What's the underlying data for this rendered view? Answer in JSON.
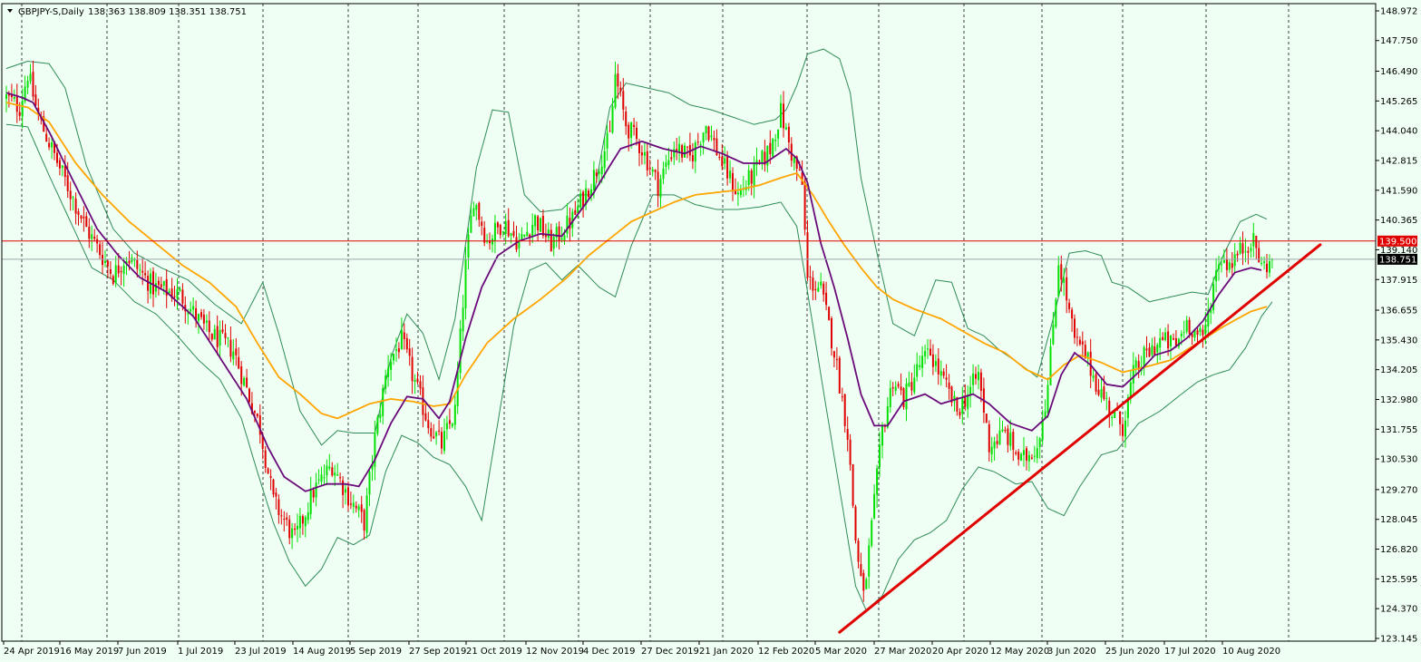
{
  "window": {
    "title": "GBPJPY-S,Daily",
    "ohlc": "138.363 138.809 138.351 138.751",
    "collapse_icon": "triangle-down-icon"
  },
  "colors": {
    "background": "#F0FFF4",
    "bull": "#00E000",
    "bear": "#E00000",
    "ma_fast": "#6A0A7A",
    "ma_slow": "#FFA500",
    "bands": "#2E8B57",
    "level_line": "#E00000",
    "current_line": "#9AA4AC",
    "trendline": "#E00000",
    "grid": "#000000"
  },
  "chart_data": {
    "type": "candlestick",
    "title": "GBPJPY-S,Daily",
    "ylim": [
      123.145,
      148.972
    ],
    "y_ticks": [
      "148.972",
      "147.750",
      "146.490",
      "145.265",
      "144.040",
      "142.815",
      "141.590",
      "140.365",
      "139.140",
      "137.915",
      "136.655",
      "135.430",
      "134.205",
      "132.980",
      "131.755",
      "130.530",
      "129.270",
      "128.045",
      "126.820",
      "125.595",
      "124.370",
      "123.145"
    ],
    "x_labels": [
      "24 Apr 2019",
      "16 May 2019",
      "7 Jun 2019",
      "1 Jul 2019",
      "23 Jul 2019",
      "14 Aug 2019",
      "5 Sep 2019",
      "27 Sep 2019",
      "21 Oct 2019",
      "12 Nov 2019",
      "4 Dec 2019",
      "27 Dec 2019",
      "21 Jan 2020",
      "12 Feb 2020",
      "5 Mar 2020",
      "27 Mar 2020",
      "20 Apr 2020",
      "12 May 2020",
      "3 Jun 2020",
      "25 Jun 2020",
      "17 Jul 2020",
      "10 Aug 2020"
    ],
    "grid": "vertical-dashed",
    "key_path": [
      [
        0,
        145.4
      ],
      [
        5,
        145.0
      ],
      [
        8,
        146.4
      ],
      [
        12,
        144.6
      ],
      [
        20,
        142.5
      ],
      [
        30,
        140.0
      ],
      [
        40,
        138.1
      ],
      [
        45,
        138.9
      ],
      [
        55,
        137.6
      ],
      [
        65,
        137.3
      ],
      [
        75,
        135.8
      ],
      [
        85,
        135.0
      ],
      [
        95,
        131.8
      ],
      [
        100,
        128.8
      ],
      [
        108,
        127.2
      ],
      [
        115,
        129.2
      ],
      [
        122,
        130.3
      ],
      [
        128,
        129.0
      ],
      [
        134,
        127.9
      ],
      [
        138,
        131.4
      ],
      [
        143,
        134.5
      ],
      [
        148,
        135.4
      ],
      [
        152,
        134.0
      ],
      [
        158,
        132.0
      ],
      [
        163,
        131.1
      ],
      [
        168,
        132.5
      ],
      [
        172,
        138.5
      ],
      [
        175,
        141.3
      ],
      [
        180,
        139.5
      ],
      [
        186,
        140.3
      ],
      [
        192,
        139.4
      ],
      [
        198,
        140.4
      ],
      [
        204,
        139.4
      ],
      [
        212,
        140.4
      ],
      [
        220,
        142.2
      ],
      [
        226,
        143.8
      ],
      [
        228,
        146.3
      ],
      [
        232,
        144.3
      ],
      [
        238,
        143.3
      ],
      [
        244,
        141.8
      ],
      [
        250,
        143.4
      ],
      [
        256,
        142.9
      ],
      [
        262,
        144.3
      ],
      [
        268,
        142.7
      ],
      [
        274,
        141.4
      ],
      [
        280,
        142.3
      ],
      [
        286,
        143.3
      ],
      [
        290,
        144.8
      ],
      [
        294,
        143.1
      ],
      [
        298,
        141.8
      ],
      [
        300,
        137.9
      ],
      [
        305,
        137.5
      ],
      [
        310,
        135.0
      ],
      [
        315,
        131.6
      ],
      [
        318,
        127.2
      ],
      [
        321,
        124.8
      ],
      [
        324,
        127.7
      ],
      [
        328,
        131.7
      ],
      [
        332,
        133.8
      ],
      [
        336,
        133.0
      ],
      [
        342,
        134.4
      ],
      [
        346,
        134.9
      ],
      [
        350,
        133.9
      ],
      [
        356,
        132.5
      ],
      [
        361,
        133.4
      ],
      [
        364,
        134.0
      ],
      [
        368,
        131.1
      ],
      [
        374,
        131.6
      ],
      [
        380,
        130.4
      ],
      [
        386,
        131.1
      ],
      [
        390,
        133.5
      ],
      [
        394,
        138.7
      ],
      [
        396,
        137.7
      ],
      [
        400,
        135.4
      ],
      [
        404,
        134.8
      ],
      [
        408,
        133.7
      ],
      [
        414,
        132.4
      ],
      [
        418,
        131.9
      ],
      [
        422,
        134.0
      ],
      [
        426,
        134.7
      ],
      [
        432,
        135.4
      ],
      [
        438,
        135.2
      ],
      [
        442,
        136.2
      ],
      [
        448,
        135.4
      ],
      [
        454,
        138.8
      ],
      [
        458,
        138.6
      ],
      [
        464,
        139.3
      ],
      [
        466,
        139.6
      ],
      [
        468,
        139.2
      ],
      [
        470,
        138.4
      ],
      [
        474,
        138.75
      ]
    ],
    "ma_fast_path": [
      [
        0,
        145.6
      ],
      [
        6,
        145.4
      ],
      [
        10,
        145.2
      ],
      [
        16,
        144.0
      ],
      [
        24,
        142.2
      ],
      [
        34,
        140.0
      ],
      [
        42,
        138.9
      ],
      [
        50,
        138.0
      ],
      [
        60,
        137.4
      ],
      [
        70,
        136.4
      ],
      [
        80,
        134.7
      ],
      [
        90,
        133.0
      ],
      [
        98,
        131.0
      ],
      [
        104,
        129.8
      ],
      [
        112,
        129.2
      ],
      [
        120,
        129.5
      ],
      [
        127,
        129.5
      ],
      [
        132,
        129.4
      ],
      [
        138,
        130.5
      ],
      [
        144,
        132.0
      ],
      [
        150,
        133.1
      ],
      [
        156,
        133.0
      ],
      [
        162,
        132.2
      ],
      [
        166,
        132.9
      ],
      [
        172,
        135.5
      ],
      [
        178,
        137.6
      ],
      [
        184,
        138.9
      ],
      [
        192,
        139.5
      ],
      [
        200,
        139.8
      ],
      [
        208,
        139.7
      ],
      [
        214,
        140.6
      ],
      [
        220,
        141.5
      ],
      [
        226,
        142.6
      ],
      [
        230,
        143.3
      ],
      [
        238,
        143.6
      ],
      [
        246,
        143.3
      ],
      [
        254,
        143.1
      ],
      [
        260,
        143.4
      ],
      [
        268,
        143.1
      ],
      [
        276,
        142.7
      ],
      [
        284,
        142.7
      ],
      [
        292,
        143.3
      ],
      [
        296,
        142.9
      ],
      [
        300,
        141.9
      ],
      [
        305,
        139.4
      ],
      [
        310,
        137.6
      ],
      [
        315,
        135.5
      ],
      [
        320,
        133.2
      ],
      [
        325,
        131.9
      ],
      [
        330,
        131.9
      ],
      [
        336,
        132.9
      ],
      [
        344,
        133.2
      ],
      [
        350,
        132.8
      ],
      [
        356,
        133.0
      ],
      [
        362,
        133.2
      ],
      [
        368,
        132.8
      ],
      [
        376,
        132.0
      ],
      [
        384,
        131.7
      ],
      [
        390,
        132.3
      ],
      [
        395,
        134.0
      ],
      [
        400,
        134.9
      ],
      [
        406,
        134.4
      ],
      [
        412,
        133.6
      ],
      [
        418,
        133.5
      ],
      [
        424,
        134.1
      ],
      [
        430,
        134.8
      ],
      [
        436,
        135.0
      ],
      [
        442,
        135.5
      ],
      [
        448,
        136.2
      ],
      [
        454,
        137.3
      ],
      [
        460,
        138.2
      ],
      [
        466,
        138.4
      ],
      [
        470,
        138.3
      ]
    ],
    "ma_slow_path": [
      [
        0,
        145.2
      ],
      [
        8,
        145.0
      ],
      [
        16,
        144.4
      ],
      [
        26,
        142.7
      ],
      [
        36,
        141.4
      ],
      [
        46,
        140.3
      ],
      [
        56,
        139.4
      ],
      [
        66,
        138.5
      ],
      [
        76,
        137.8
      ],
      [
        86,
        136.8
      ],
      [
        94,
        135.3
      ],
      [
        102,
        133.9
      ],
      [
        110,
        133.2
      ],
      [
        118,
        132.4
      ],
      [
        124,
        132.2
      ],
      [
        130,
        132.5
      ],
      [
        136,
        132.8
      ],
      [
        144,
        133.0
      ],
      [
        152,
        132.9
      ],
      [
        160,
        132.7
      ],
      [
        166,
        132.8
      ],
      [
        172,
        134.0
      ],
      [
        180,
        135.3
      ],
      [
        190,
        136.3
      ],
      [
        200,
        137.1
      ],
      [
        210,
        138.0
      ],
      [
        218,
        138.9
      ],
      [
        226,
        139.6
      ],
      [
        234,
        140.3
      ],
      [
        242,
        140.7
      ],
      [
        250,
        141.1
      ],
      [
        258,
        141.4
      ],
      [
        266,
        141.5
      ],
      [
        274,
        141.6
      ],
      [
        282,
        141.8
      ],
      [
        290,
        142.1
      ],
      [
        296,
        142.3
      ],
      [
        302,
        141.4
      ],
      [
        308,
        140.3
      ],
      [
        314,
        139.3
      ],
      [
        320,
        138.4
      ],
      [
        326,
        137.6
      ],
      [
        332,
        137.1
      ],
      [
        340,
        136.7
      ],
      [
        350,
        136.3
      ],
      [
        358,
        135.8
      ],
      [
        366,
        135.3
      ],
      [
        374,
        134.9
      ],
      [
        382,
        134.2
      ],
      [
        390,
        133.8
      ],
      [
        396,
        134.4
      ],
      [
        402,
        134.8
      ],
      [
        410,
        134.5
      ],
      [
        418,
        134.1
      ],
      [
        426,
        134.3
      ],
      [
        436,
        134.6
      ],
      [
        446,
        135.3
      ],
      [
        456,
        136.0
      ],
      [
        466,
        136.6
      ],
      [
        472,
        136.8
      ]
    ],
    "band_upper_path": [
      [
        0,
        146.6
      ],
      [
        8,
        146.9
      ],
      [
        16,
        146.8
      ],
      [
        22,
        145.8
      ],
      [
        30,
        142.6
      ],
      [
        40,
        140.0
      ],
      [
        48,
        139.0
      ],
      [
        58,
        138.4
      ],
      [
        68,
        137.9
      ],
      [
        78,
        136.9
      ],
      [
        88,
        136.1
      ],
      [
        96,
        137.8
      ],
      [
        102,
        135.7
      ],
      [
        110,
        132.5
      ],
      [
        118,
        131.1
      ],
      [
        124,
        131.7
      ],
      [
        130,
        131.6
      ],
      [
        138,
        131.6
      ],
      [
        144,
        134.7
      ],
      [
        150,
        136.5
      ],
      [
        156,
        135.7
      ],
      [
        162,
        133.8
      ],
      [
        168,
        136.3
      ],
      [
        176,
        142.5
      ],
      [
        182,
        144.9
      ],
      [
        188,
        144.8
      ],
      [
        194,
        141.4
      ],
      [
        200,
        140.7
      ],
      [
        208,
        140.8
      ],
      [
        214,
        141.4
      ],
      [
        220,
        141.4
      ],
      [
        226,
        145.0
      ],
      [
        232,
        146.0
      ],
      [
        240,
        145.8
      ],
      [
        248,
        145.6
      ],
      [
        256,
        145.1
      ],
      [
        264,
        144.9
      ],
      [
        272,
        144.6
      ],
      [
        280,
        144.3
      ],
      [
        288,
        144.5
      ],
      [
        292,
        144.9
      ],
      [
        296,
        145.9
      ],
      [
        300,
        147.2
      ],
      [
        306,
        147.4
      ],
      [
        312,
        147.0
      ],
      [
        316,
        145.6
      ],
      [
        320,
        142.1
      ],
      [
        326,
        139.0
      ],
      [
        332,
        136.1
      ],
      [
        340,
        135.6
      ],
      [
        348,
        137.9
      ],
      [
        354,
        137.8
      ],
      [
        360,
        135.9
      ],
      [
        366,
        135.6
      ],
      [
        372,
        135.0
      ],
      [
        380,
        134.4
      ],
      [
        386,
        133.9
      ],
      [
        392,
        136.3
      ],
      [
        398,
        139.0
      ],
      [
        404,
        139.1
      ],
      [
        410,
        138.9
      ],
      [
        414,
        137.8
      ],
      [
        420,
        137.6
      ],
      [
        428,
        137.0
      ],
      [
        436,
        137.2
      ],
      [
        444,
        137.4
      ],
      [
        450,
        137.3
      ],
      [
        456,
        139.0
      ],
      [
        462,
        140.3
      ],
      [
        468,
        140.6
      ],
      [
        472,
        140.4
      ]
    ],
    "band_lower_path": [
      [
        0,
        144.3
      ],
      [
        8,
        144.2
      ],
      [
        16,
        142.2
      ],
      [
        24,
        140.3
      ],
      [
        32,
        138.4
      ],
      [
        40,
        137.9
      ],
      [
        48,
        137.0
      ],
      [
        56,
        136.5
      ],
      [
        64,
        135.6
      ],
      [
        72,
        134.6
      ],
      [
        80,
        133.8
      ],
      [
        88,
        132.2
      ],
      [
        94,
        130.0
      ],
      [
        100,
        127.9
      ],
      [
        106,
        126.3
      ],
      [
        112,
        125.3
      ],
      [
        118,
        126.0
      ],
      [
        124,
        127.3
      ],
      [
        130,
        127.0
      ],
      [
        136,
        127.4
      ],
      [
        142,
        130.0
      ],
      [
        148,
        131.5
      ],
      [
        154,
        131.2
      ],
      [
        160,
        130.6
      ],
      [
        166,
        130.3
      ],
      [
        172,
        129.4
      ],
      [
        178,
        128.0
      ],
      [
        184,
        132.0
      ],
      [
        190,
        136.0
      ],
      [
        196,
        138.3
      ],
      [
        202,
        138.6
      ],
      [
        208,
        137.9
      ],
      [
        214,
        138.5
      ],
      [
        222,
        137.6
      ],
      [
        228,
        137.2
      ],
      [
        234,
        139.3
      ],
      [
        242,
        141.4
      ],
      [
        250,
        141.4
      ],
      [
        258,
        141.0
      ],
      [
        266,
        140.8
      ],
      [
        274,
        140.8
      ],
      [
        282,
        140.9
      ],
      [
        290,
        141.1
      ],
      [
        296,
        140.1
      ],
      [
        300,
        137.4
      ],
      [
        306,
        133.3
      ],
      [
        312,
        129.3
      ],
      [
        318,
        125.3
      ],
      [
        322,
        124.3
      ],
      [
        328,
        124.9
      ],
      [
        334,
        126.4
      ],
      [
        340,
        127.2
      ],
      [
        346,
        127.5
      ],
      [
        352,
        128.0
      ],
      [
        358,
        129.3
      ],
      [
        364,
        130.2
      ],
      [
        370,
        130.0
      ],
      [
        378,
        129.5
      ],
      [
        384,
        129.6
      ],
      [
        390,
        128.5
      ],
      [
        396,
        128.2
      ],
      [
        402,
        129.4
      ],
      [
        410,
        130.7
      ],
      [
        416,
        130.9
      ],
      [
        424,
        132.0
      ],
      [
        432,
        132.5
      ],
      [
        440,
        133.2
      ],
      [
        446,
        133.7
      ],
      [
        452,
        134.0
      ],
      [
        458,
        134.2
      ],
      [
        464,
        135.1
      ],
      [
        470,
        136.4
      ],
      [
        474,
        137.0
      ]
    ],
    "horizontal_level": 139.5,
    "current_price": 138.751,
    "level_label": "139.500",
    "price_label": "138.751",
    "trendline": {
      "from": [
        312,
        123.4
      ],
      "to": [
        492,
        139.35
      ]
    }
  }
}
